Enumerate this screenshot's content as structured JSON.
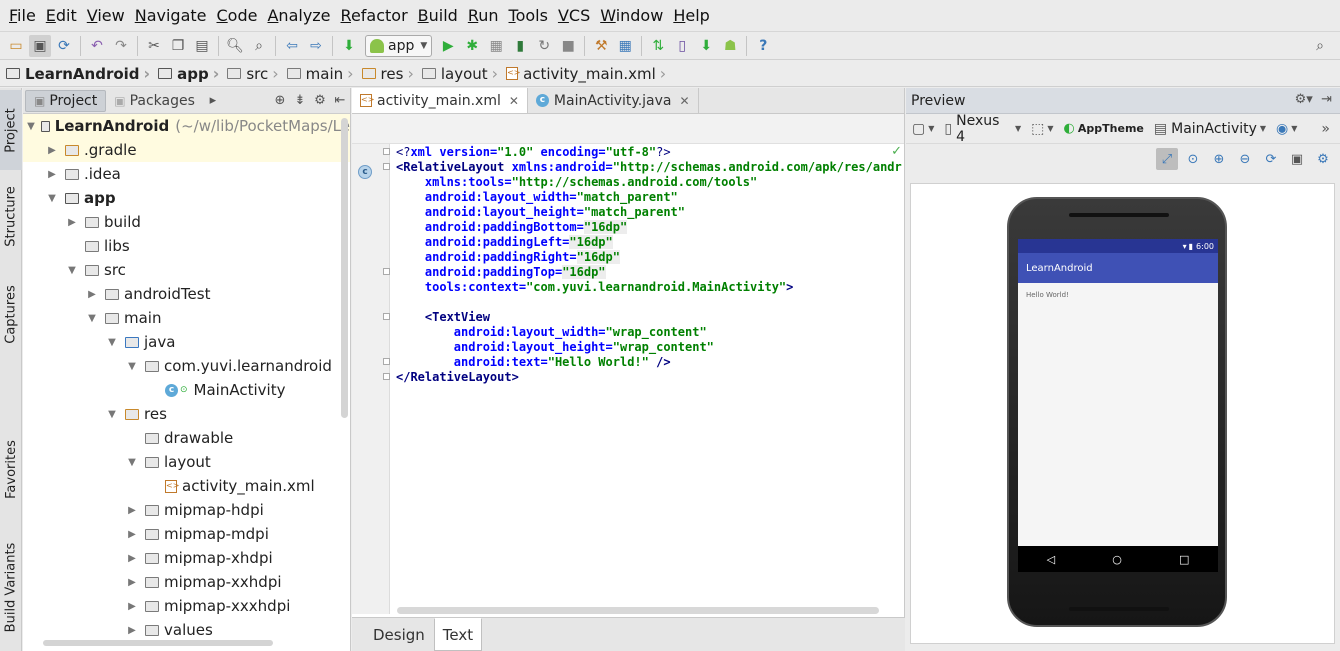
{
  "menu": [
    "File",
    "Edit",
    "View",
    "Navigate",
    "Code",
    "Analyze",
    "Refactor",
    "Build",
    "Run",
    "Tools",
    "VCS",
    "Window",
    "Help"
  ],
  "toolbar": {
    "run_config": "app"
  },
  "breadcrumb": [
    "LearnAndroid",
    "app",
    "src",
    "main",
    "res",
    "layout",
    "activity_main.xml"
  ],
  "left_strip": {
    "project": "Project",
    "structure": "Structure",
    "captures": "Captures",
    "favorites": "Favorites",
    "build_variants": "Build Variants"
  },
  "project": {
    "tabs": [
      "Project",
      "Packages"
    ],
    "tree": [
      {
        "label": "LearnAndroid",
        "extra": "(~/w/lib/PocketMaps/Le"
      },
      {
        "label": ".gradle"
      },
      {
        "label": ".idea"
      },
      {
        "label": "app"
      },
      {
        "label": "build"
      },
      {
        "label": "libs"
      },
      {
        "label": "src"
      },
      {
        "label": "androidTest"
      },
      {
        "label": "main"
      },
      {
        "label": "java"
      },
      {
        "label": "com.yuvi.learnandroid"
      },
      {
        "label": "MainActivity"
      },
      {
        "label": "res"
      },
      {
        "label": "drawable"
      },
      {
        "label": "layout"
      },
      {
        "label": "activity_main.xml"
      },
      {
        "label": "mipmap-hdpi"
      },
      {
        "label": "mipmap-mdpi"
      },
      {
        "label": "mipmap-xhdpi"
      },
      {
        "label": "mipmap-xxhdpi"
      },
      {
        "label": "mipmap-xxxhdpi"
      },
      {
        "label": "values"
      }
    ]
  },
  "editor": {
    "tabs": [
      {
        "label": "activity_main.xml"
      },
      {
        "label": "MainActivity.java"
      }
    ],
    "bottom_tabs": [
      "Design",
      "Text"
    ],
    "code": {
      "l1_a": "<?",
      "l1_b": "xml version",
      "l1_c": "=",
      "l1_d": "\"1.0\"",
      "l1_e": " encoding",
      "l1_f": "=",
      "l1_g": "\"utf-8\"",
      "l1_h": "?>",
      "l2_tag": "<RelativeLayout",
      "l2_attr": " xmlns:android",
      "l2_eq": "=",
      "l2_val": "\"http://schemas.android.com/apk/res/android\"",
      "l3_attr": "    xmlns:tools",
      "l3_eq": "=",
      "l3_val": "\"http://schemas.android.com/tools\"",
      "l4_attr": "    android:layout_width",
      "l4_eq": "=",
      "l4_val": "\"match_parent\"",
      "l5_attr": "    android:layout_height",
      "l5_eq": "=",
      "l5_val": "\"match_parent\"",
      "l6_attr": "    android:paddingBottom",
      "l6_eq": "=",
      "l6_val": "\"16dp\"",
      "l7_attr": "    android:paddingLeft",
      "l7_eq": "=",
      "l7_val": "\"16dp\"",
      "l8_attr": "    android:paddingRight",
      "l8_eq": "=",
      "l8_val": "\"16dp\"",
      "l9_attr": "    android:paddingTop",
      "l9_eq": "=",
      "l9_val": "\"16dp\"",
      "l10_attr": "    tools:context",
      "l10_eq": "=",
      "l10_val": "\"com.yuvi.learnandroid.MainActivity\"",
      "l10_end": ">",
      "l12_tag": "    <TextView",
      "l13_attr": "        android:layout_width",
      "l13_eq": "=",
      "l13_val": "\"wrap_content\"",
      "l14_attr": "        android:layout_height",
      "l14_eq": "=",
      "l14_val": "\"wrap_content\"",
      "l15_attr": "        android:text",
      "l15_eq": "=",
      "l15_val": "\"Hello World!\"",
      "l15_end": " />",
      "l16_tag": "</RelativeLayout>"
    }
  },
  "preview": {
    "title": "Preview",
    "device": "Nexus 4",
    "theme": "AppTheme",
    "activity": "MainActivity",
    "phone": {
      "time": "6:00",
      "app_title": "LearnAndroid",
      "content": "Hello World!"
    }
  },
  "colors": {
    "action_bar": "#3f51b5",
    "status_bar": "#283593",
    "run_green": "#2fae3a"
  }
}
